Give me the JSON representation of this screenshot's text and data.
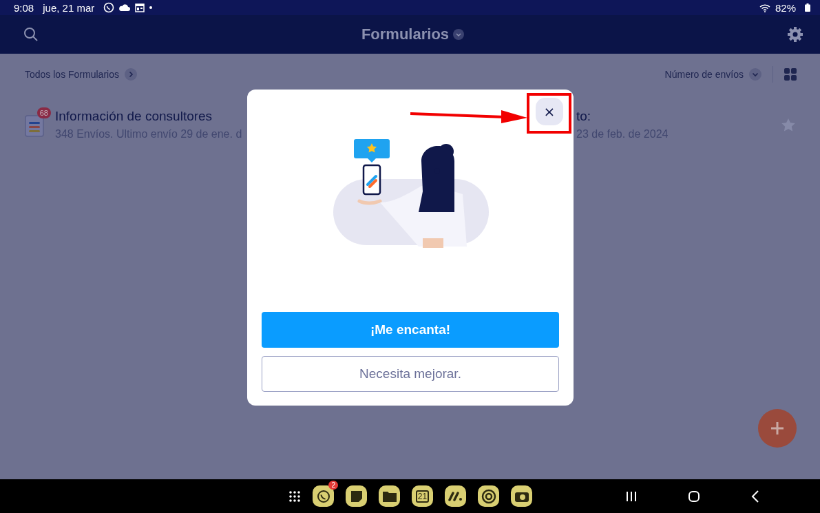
{
  "status_bar": {
    "time": "9:08",
    "date": "jue, 21 mar",
    "battery": "82%"
  },
  "header": {
    "title": "Formularios"
  },
  "toolbar": {
    "breadcrumb": "Todos los Formularios",
    "sort": "Número de envíos"
  },
  "forms": [
    {
      "kind": "form",
      "title": "Información de consultores",
      "subtitle": "348 Envíos. Ultimo envío 29 de ene. d",
      "badge": "68"
    },
    {
      "kind": "clipped",
      "title": "to:",
      "subtitle": "23 de feb. de 2024"
    }
  ],
  "dialog": {
    "close": "×",
    "buttons": [
      {
        "kind": "primary",
        "label": "¡Me encanta!"
      },
      {
        "kind": "secondary",
        "label": "Necesita mejorar."
      }
    ]
  },
  "taskbar": {
    "apps": [
      {
        "kind": "whatsapp",
        "badge": "2"
      },
      {
        "kind": "notes"
      },
      {
        "kind": "folder"
      },
      {
        "kind": "calendar",
        "label": "21"
      },
      {
        "kind": "monday"
      },
      {
        "kind": "chrome"
      },
      {
        "kind": "camera"
      }
    ]
  }
}
